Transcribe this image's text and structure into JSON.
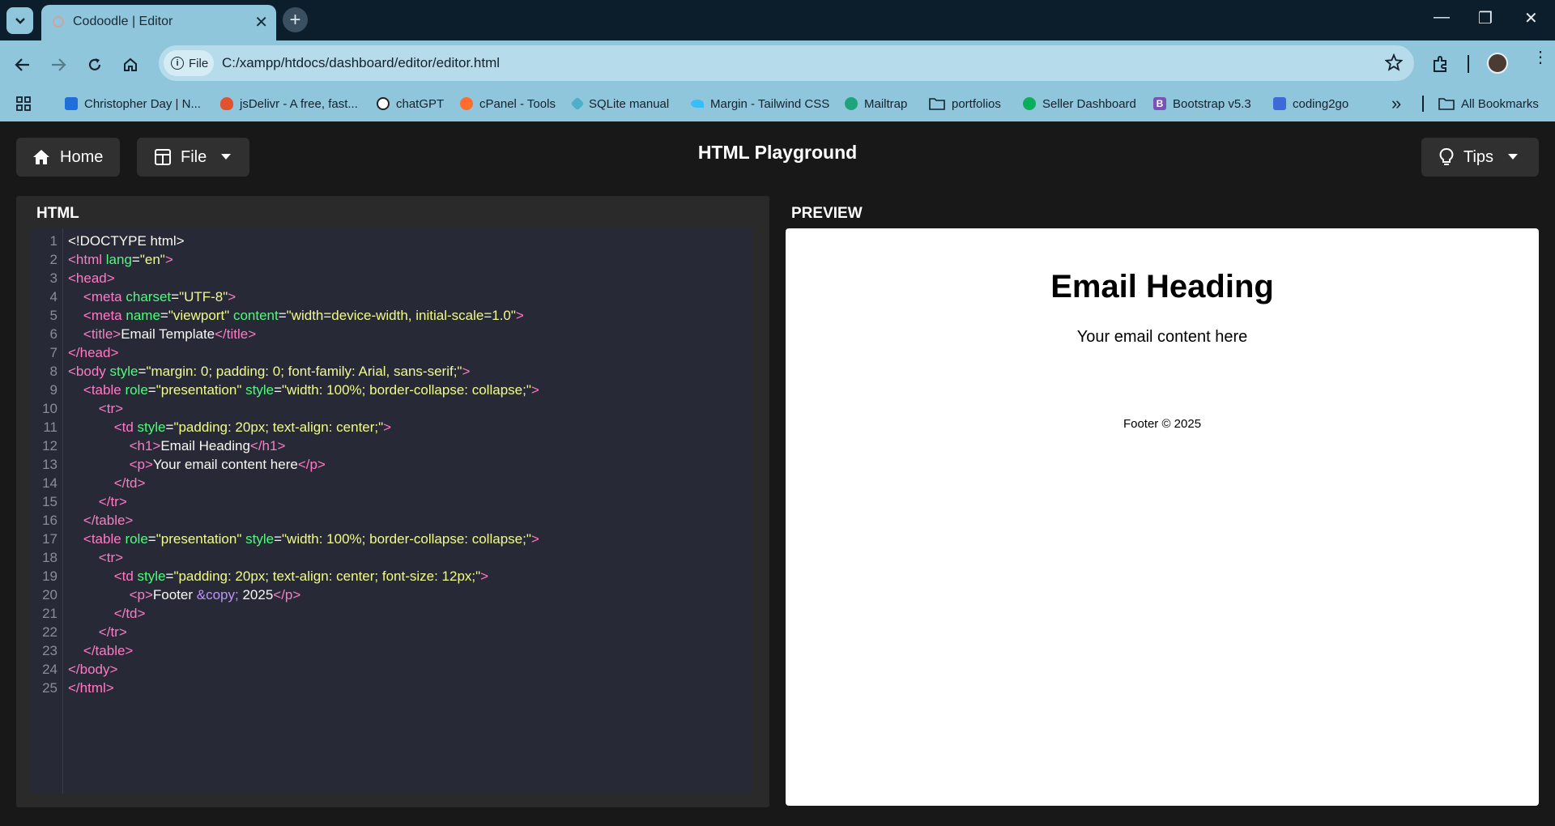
{
  "browser": {
    "tab_title": "Codoodle | Editor",
    "address": {
      "chip_label": "File",
      "url": "C:/xampp/htdocs/dashboard/editor/editor.html"
    },
    "bookmarks": [
      {
        "label": "Christopher Day | N...",
        "color": "#1e6fd9"
      },
      {
        "label": "jsDelivr - A free, fast...",
        "color": "#e2522c"
      },
      {
        "label": "chatGPT",
        "color": "#222222"
      },
      {
        "label": "cPanel - Tools",
        "color": "#ff6c2c"
      },
      {
        "label": "SQLite manual",
        "color": "#4bb0c8"
      },
      {
        "label": "Margin - Tailwind CSS",
        "color": "#38bdf8"
      },
      {
        "label": "Mailtrap",
        "color": "#1fa37a"
      },
      {
        "label": "portfolios",
        "color": "folder"
      },
      {
        "label": "Seller Dashboard",
        "color": "#0bae5a"
      },
      {
        "label": "Bootstrap v5.3",
        "color": "#7952b3"
      },
      {
        "label": "coding2go",
        "color": "#3d6ad6"
      }
    ],
    "overflow_label": "»",
    "all_bookmarks": "All Bookmarks"
  },
  "app": {
    "home_label": "Home",
    "file_label": "File",
    "title": "HTML Playground",
    "tips_label": "Tips",
    "html_panel_label": "HTML",
    "preview_label": "PREVIEW"
  },
  "editor": {
    "line_count": 25
  },
  "preview": {
    "heading": "Email Heading",
    "content": "Your email content here",
    "footer": "Footer © 2025"
  }
}
